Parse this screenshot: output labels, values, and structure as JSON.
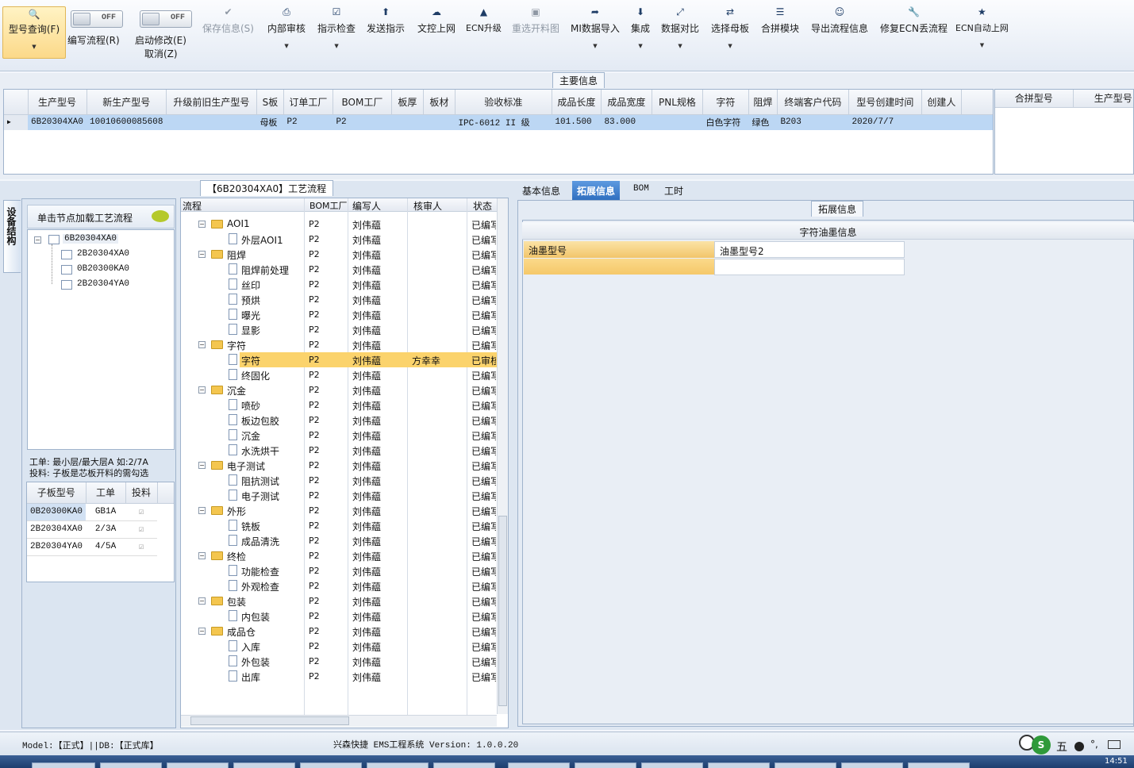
{
  "toolbar": {
    "query": "型号查询(F)",
    "write_flow": "编写流程(R)",
    "toggle_off": "OFF",
    "auto_modify": "启动修改(E)",
    "cancel": "取消(Z)",
    "save": "保存信息(S)",
    "internal_review": "内部审核",
    "instruction_check": "指示检查",
    "send_instruction": "发送指示",
    "doc_upload": "文控上网",
    "ecn_upgrade": "ECN升级",
    "reselect_cut": "重选开料图",
    "mi_import": "MI数据导入",
    "integrate": "集成",
    "data_compare": "数据对比",
    "select_mother": "选择母板",
    "merge_module": "合拼模块",
    "export_flow": "导出流程信息",
    "repair_ecn": "修复ECN丢流程",
    "ecn_auto": "ECN自动上网"
  },
  "main": {
    "caption": "主要信息",
    "columns": [
      "生产型号",
      "新生产型号",
      "升级前旧生产型号",
      "S板",
      "订单工厂",
      "BOM工厂",
      "板厚",
      "板材",
      "验收标准",
      "成品长度",
      "成品宽度",
      "PNL规格",
      "字符",
      "阻焊",
      "终端客户代码",
      "型号创建时间",
      "创建人"
    ],
    "row": [
      "6B20304XA0",
      "10010600085608",
      "",
      "母板",
      "P2",
      "P2",
      "",
      "",
      "IPC-6012 II 级",
      "101.500",
      "83.000",
      "",
      "白色字符",
      "绿色",
      "B203",
      "2020/7/7",
      ""
    ],
    "right_columns": [
      "合拼型号",
      "生产型号"
    ]
  },
  "side": {
    "tab": "设备结构",
    "hint": "单击节点加载工艺流程",
    "tree_root": "6B20304XA0",
    "tree_children": [
      "2B20304XA0",
      "0B20300KA0",
      "2B20304YA0"
    ],
    "note1": "工单: 最小层/最大层A 如:2/7A",
    "note2": "投料: 子板是芯板开料的需勾选",
    "sub_columns": [
      "子板型号",
      "工单",
      "投料"
    ],
    "sub_rows": [
      {
        "model": "0B20300KA0",
        "order": "GB1A"
      },
      {
        "model": "2B20304XA0",
        "order": "2/3A"
      },
      {
        "model": "2B20304YA0",
        "order": "4/5A"
      }
    ]
  },
  "flow": {
    "caption": "【6B20304XA0】工艺流程",
    "columns": [
      "流程",
      "BOM工厂",
      "编写人",
      "核审人",
      "状态"
    ],
    "rows": [
      {
        "name": "AOI1",
        "folder": true,
        "level": 0,
        "f": "P2",
        "w": "刘伟藴",
        "r": "",
        "s": "已编写"
      },
      {
        "name": "外层AOI1",
        "folder": false,
        "level": 1,
        "f": "P2",
        "w": "刘伟藴",
        "r": "",
        "s": "已编写"
      },
      {
        "name": "阻焊",
        "folder": true,
        "level": 0,
        "f": "P2",
        "w": "刘伟藴",
        "r": "",
        "s": "已编写"
      },
      {
        "name": "阻焊前处理",
        "folder": false,
        "level": 1,
        "f": "P2",
        "w": "刘伟藴",
        "r": "",
        "s": "已编写"
      },
      {
        "name": "丝印",
        "folder": false,
        "level": 1,
        "f": "P2",
        "w": "刘伟藴",
        "r": "",
        "s": "已编写"
      },
      {
        "name": "预烘",
        "folder": false,
        "level": 1,
        "f": "P2",
        "w": "刘伟藴",
        "r": "",
        "s": "已编写"
      },
      {
        "name": "曝光",
        "folder": false,
        "level": 1,
        "f": "P2",
        "w": "刘伟藴",
        "r": "",
        "s": "已编写"
      },
      {
        "name": "显影",
        "folder": false,
        "level": 1,
        "f": "P2",
        "w": "刘伟藴",
        "r": "",
        "s": "已编写"
      },
      {
        "name": "字符",
        "folder": true,
        "level": 0,
        "f": "P2",
        "w": "刘伟藴",
        "r": "",
        "s": "已编写"
      },
      {
        "name": "字符",
        "folder": false,
        "level": 1,
        "f": "P2",
        "w": "刘伟藴",
        "r": "方幸幸",
        "s": "已审核",
        "sel": true
      },
      {
        "name": "终固化",
        "folder": false,
        "level": 1,
        "f": "P2",
        "w": "刘伟藴",
        "r": "",
        "s": "已编写"
      },
      {
        "name": "沉金",
        "folder": true,
        "level": 0,
        "f": "P2",
        "w": "刘伟藴",
        "r": "",
        "s": "已编写"
      },
      {
        "name": "喷砂",
        "folder": false,
        "level": 1,
        "f": "P2",
        "w": "刘伟藴",
        "r": "",
        "s": "已编写"
      },
      {
        "name": "板边包胶",
        "folder": false,
        "level": 1,
        "f": "P2",
        "w": "刘伟藴",
        "r": "",
        "s": "已编写"
      },
      {
        "name": "沉金",
        "folder": false,
        "level": 1,
        "f": "P2",
        "w": "刘伟藴",
        "r": "",
        "s": "已编写"
      },
      {
        "name": "水洗烘干",
        "folder": false,
        "level": 1,
        "f": "P2",
        "w": "刘伟藴",
        "r": "",
        "s": "已编写"
      },
      {
        "name": "电子测试",
        "folder": true,
        "level": 0,
        "f": "P2",
        "w": "刘伟藴",
        "r": "",
        "s": "已编写"
      },
      {
        "name": "阻抗测试",
        "folder": false,
        "level": 1,
        "f": "P2",
        "w": "刘伟藴",
        "r": "",
        "s": "已编写"
      },
      {
        "name": "电子测试",
        "folder": false,
        "level": 1,
        "f": "P2",
        "w": "刘伟藴",
        "r": "",
        "s": "已编写"
      },
      {
        "name": "外形",
        "folder": true,
        "level": 0,
        "f": "P2",
        "w": "刘伟藴",
        "r": "",
        "s": "已编写"
      },
      {
        "name": "铣板",
        "folder": false,
        "level": 1,
        "f": "P2",
        "w": "刘伟藴",
        "r": "",
        "s": "已编写"
      },
      {
        "name": "成品清洗",
        "folder": false,
        "level": 1,
        "f": "P2",
        "w": "刘伟藴",
        "r": "",
        "s": "已编写"
      },
      {
        "name": "终检",
        "folder": true,
        "level": 0,
        "f": "P2",
        "w": "刘伟藴",
        "r": "",
        "s": "已编写"
      },
      {
        "name": "功能检查",
        "folder": false,
        "level": 1,
        "f": "P2",
        "w": "刘伟藴",
        "r": "",
        "s": "已编写"
      },
      {
        "name": "外观检查",
        "folder": false,
        "level": 1,
        "f": "P2",
        "w": "刘伟藴",
        "r": "",
        "s": "已编写"
      },
      {
        "name": "包装",
        "folder": true,
        "level": 0,
        "f": "P2",
        "w": "刘伟藴",
        "r": "",
        "s": "已编写"
      },
      {
        "name": "内包装",
        "folder": false,
        "level": 1,
        "f": "P2",
        "w": "刘伟藴",
        "r": "",
        "s": "已编写"
      },
      {
        "name": "成品仓",
        "folder": true,
        "level": 0,
        "f": "P2",
        "w": "刘伟藴",
        "r": "",
        "s": "已编写"
      },
      {
        "name": "入库",
        "folder": false,
        "level": 1,
        "f": "P2",
        "w": "刘伟藴",
        "r": "",
        "s": "已编写"
      },
      {
        "name": "外包装",
        "folder": false,
        "level": 1,
        "f": "P2",
        "w": "刘伟藴",
        "r": "",
        "s": "已编写"
      },
      {
        "name": "出库",
        "folder": false,
        "level": 1,
        "f": "P2",
        "w": "刘伟藴",
        "r": "",
        "s": "已编写"
      }
    ]
  },
  "right": {
    "tabs": [
      "基本信息",
      "拓展信息",
      "BOM",
      "工时"
    ],
    "caption": "拓展信息",
    "table_title": "字符油墨信息",
    "col1": "油墨型号",
    "col2": "油墨型号2"
  },
  "status": {
    "model": "Model:【正式】||DB:【正式库】",
    "system": "兴森快捷 EMS工程系统 Version: 1.0.0.20",
    "ime": "五",
    "clock": "14:51"
  },
  "colors": {
    "accent": "#3f7fd1",
    "selected_row": "#bcd7f4",
    "highlight": "#fbd36c"
  }
}
